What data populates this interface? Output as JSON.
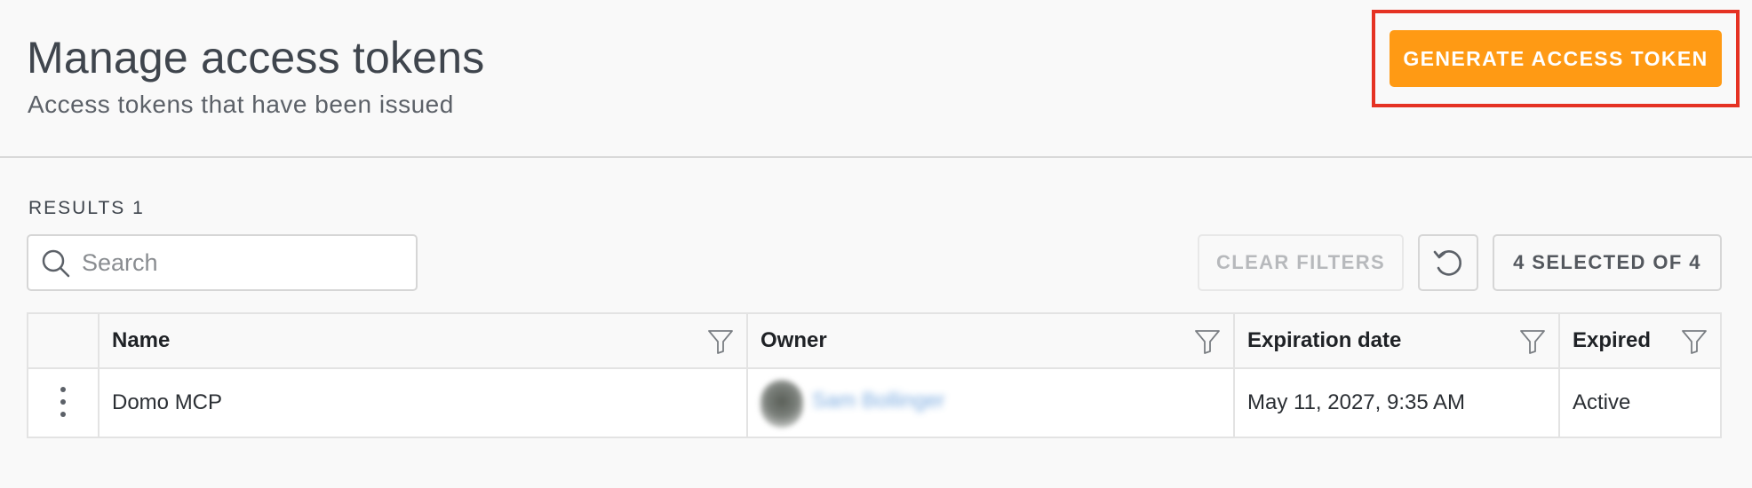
{
  "header": {
    "title": "Manage access tokens",
    "subtitle": "Access tokens that have been issued",
    "generate_button_label": "GENERATE ACCESS TOKEN",
    "highlight_color": "#e53223",
    "accent_color": "#ff9a14"
  },
  "toolbar": {
    "results_label": "RESULTS 1",
    "search_placeholder": "Search",
    "search_value": "",
    "clear_filters_label": "CLEAR FILTERS",
    "refresh_icon": "refresh-icon",
    "column_selector_label": "4 SELECTED OF 4"
  },
  "table": {
    "columns": [
      {
        "label": "Name",
        "icon": "filter-icon"
      },
      {
        "label": "Owner",
        "icon": "filter-icon"
      },
      {
        "label": "Expiration date",
        "icon": "filter-icon"
      },
      {
        "label": "Expired",
        "icon": "filter-icon"
      }
    ],
    "rows": [
      {
        "actions_icon": "kebab-menu-icon",
        "name": "Domo MCP",
        "owner": "Sam Bollinger",
        "expiration_date": "May 11, 2027, 9:35 AM",
        "expired": "Active"
      }
    ]
  }
}
